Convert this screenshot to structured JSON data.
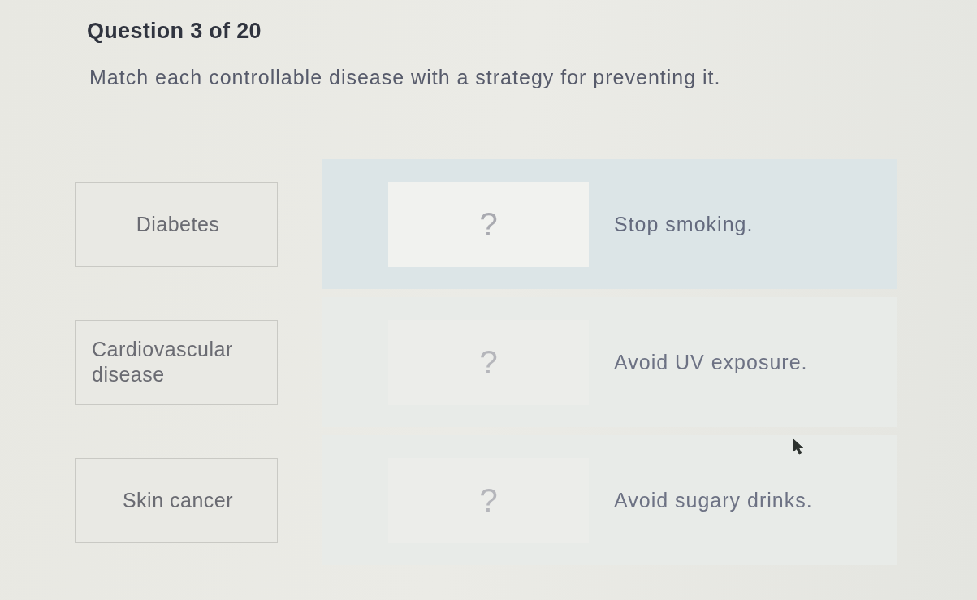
{
  "question": {
    "counter": "Question 3 of 20",
    "prompt": "Match each controllable disease with a strategy for preventing it."
  },
  "terms": [
    {
      "label": "Diabetes"
    },
    {
      "label": "Cardiovascular disease"
    },
    {
      "label": "Skin cancer"
    }
  ],
  "targets": [
    {
      "placeholder": "?",
      "strategy": "Stop smoking.",
      "selected": true
    },
    {
      "placeholder": "?",
      "strategy": "Avoid UV exposure.",
      "selected": false
    },
    {
      "placeholder": "?",
      "strategy": "Avoid sugary drinks.",
      "selected": false
    }
  ]
}
